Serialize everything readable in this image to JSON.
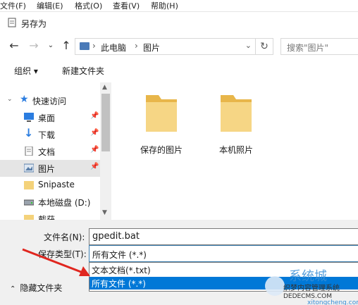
{
  "app_menu": [
    "文件(F)",
    "编辑(E)",
    "格式(O)",
    "查看(V)",
    "帮助(H)"
  ],
  "dialog": {
    "title": "另存为"
  },
  "nav": {
    "back_icon": "back-arrow-icon",
    "forward_icon": "forward-arrow-icon",
    "recent_icon": "chevron-down-icon",
    "up_icon": "up-arrow-icon",
    "breadcrumb": [
      "此电脑",
      "图片"
    ],
    "refresh_icon": "refresh-icon",
    "search_placeholder": "搜索\"图片\""
  },
  "toolbar": {
    "organize": "组织 ▾",
    "new_folder": "新建文件夹"
  },
  "sidebar": {
    "items": [
      {
        "label": "快速访问",
        "icon": "star-icon",
        "pinned": false
      },
      {
        "label": "桌面",
        "icon": "desktop-icon",
        "pinned": true
      },
      {
        "label": "下载",
        "icon": "download-icon",
        "pinned": true
      },
      {
        "label": "文档",
        "icon": "document-icon",
        "pinned": true
      },
      {
        "label": "图片",
        "icon": "pictures-icon",
        "pinned": true,
        "selected": true
      },
      {
        "label": "Snipaste",
        "icon": "folder-icon",
        "pinned": false
      },
      {
        "label": "本地磁盘 (D:)",
        "icon": "drive-icon",
        "pinned": false
      },
      {
        "label": "截获",
        "icon": "folder-icon",
        "pinned": false
      }
    ]
  },
  "folders": [
    {
      "label": "保存的图片"
    },
    {
      "label": "本机照片"
    }
  ],
  "form": {
    "filename_label": "文件名(N):",
    "filename_value": "gpedit.bat",
    "filetype_label": "保存类型(T):",
    "filetype_value": "所有文件  (*.*)",
    "filetype_options": [
      "文本文档(*.txt)",
      "所有文件  (*.*)"
    ],
    "hide_folders": "隐藏文件夹"
  },
  "watermark": {
    "brand": "系统城",
    "site_cn": "织梦内容管理系统",
    "domain1": "DEDECMS.COM",
    "domain2": "xitongcheng.com"
  },
  "colors": {
    "accent": "#0078d7",
    "folder": "#f4d27a",
    "arrow": "#e0261f"
  }
}
